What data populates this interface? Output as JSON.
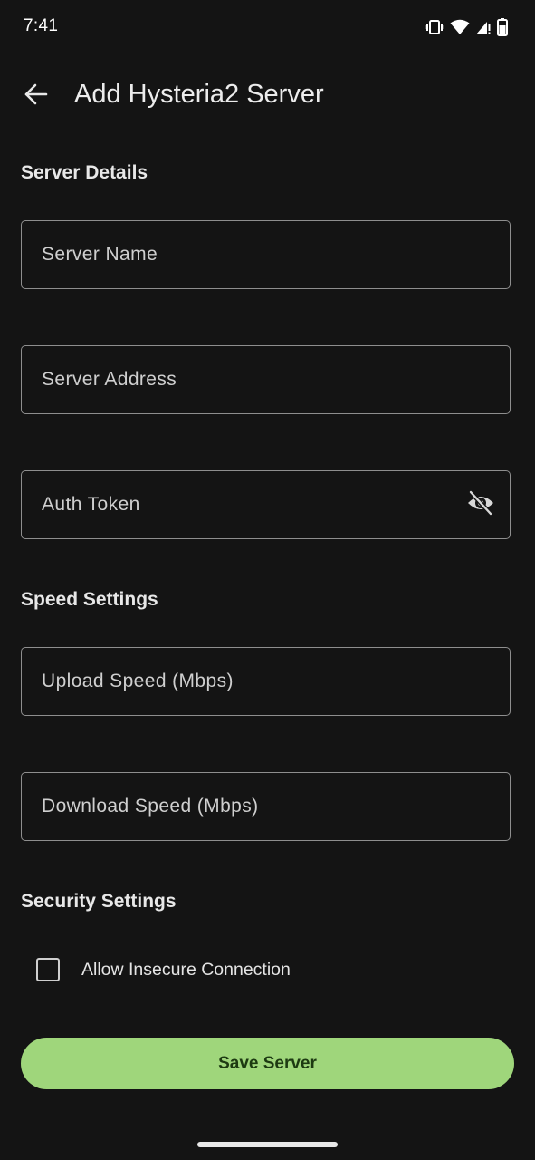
{
  "status_bar": {
    "time": "7:41",
    "icons": [
      "vibrate-icon",
      "wifi-icon",
      "cell-signal-icon",
      "battery-icon"
    ]
  },
  "app_bar": {
    "back_icon": "arrow-back-icon",
    "title": "Add Hysteria2 Server"
  },
  "sections": {
    "server_details": "Server Details",
    "speed_settings": "Speed Settings",
    "security_settings": "Security Settings"
  },
  "fields": {
    "server_name": {
      "placeholder": "Server Name",
      "value": ""
    },
    "server_address": {
      "placeholder": "Server Address",
      "value": ""
    },
    "auth_token": {
      "placeholder": "Auth Token",
      "value": "",
      "toggle_icon": "visibility-off-icon"
    },
    "upload_speed": {
      "placeholder": "Upload Speed (Mbps)",
      "value": ""
    },
    "download_speed": {
      "placeholder": "Download Speed (Mbps)",
      "value": ""
    }
  },
  "security": {
    "allow_insecure_label": "Allow Insecure Connection",
    "allow_insecure_checked": false
  },
  "actions": {
    "save_label": "Save Server"
  },
  "colors": {
    "background": "#141414",
    "accent": "#9fd67b",
    "outline": "#8e8e8e"
  }
}
